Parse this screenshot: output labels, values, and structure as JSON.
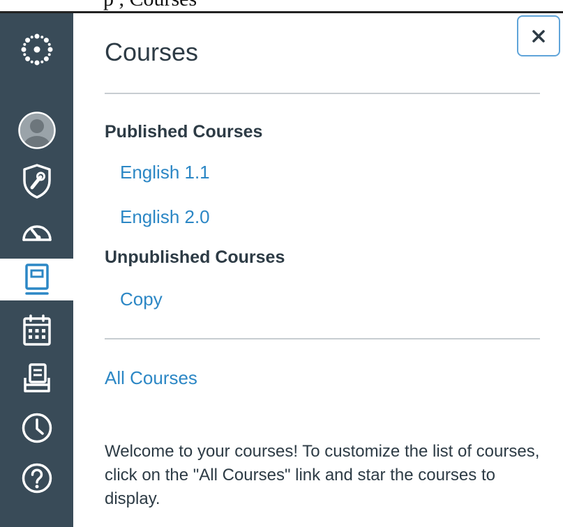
{
  "page_fragment": {
    "text": "p                         ,             Courses"
  },
  "colors": {
    "sidebar_bg": "#394b58",
    "link": "#2c87c5",
    "text": "#2d3b45",
    "active_nav_icon": "#2c87c5",
    "close_border": "#5fa4d9"
  },
  "sidebar": {
    "items": [
      {
        "icon": "logo-icon",
        "active": false
      },
      {
        "icon": "account-avatar-icon",
        "active": false
      },
      {
        "icon": "admin-shield-icon",
        "active": false
      },
      {
        "icon": "dashboard-icon",
        "active": false
      },
      {
        "icon": "courses-icon",
        "active": true
      },
      {
        "icon": "calendar-icon",
        "active": false
      },
      {
        "icon": "inbox-icon",
        "active": false
      },
      {
        "icon": "history-clock-icon",
        "active": false
      },
      {
        "icon": "help-icon",
        "active": false
      }
    ]
  },
  "tray": {
    "close_label": "×",
    "title": "Courses",
    "published_heading": "Published Courses",
    "published_courses": [
      "English 1.1",
      "English 2.0"
    ],
    "unpublished_heading": "Unpublished Courses",
    "unpublished_courses": [
      "Copy"
    ],
    "all_courses_label": "All Courses",
    "welcome_text": "Welcome to your courses! To customize the list of courses, click on the \"All Courses\" link and star the courses to display."
  }
}
